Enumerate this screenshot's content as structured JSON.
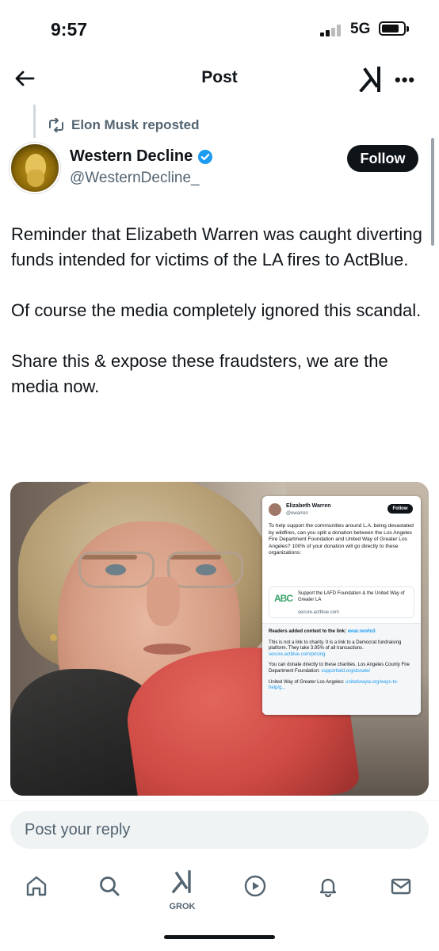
{
  "status_bar": {
    "time": "9:57",
    "network": "5G"
  },
  "header": {
    "title": "Post"
  },
  "repost": {
    "label": "Elon Musk reposted"
  },
  "author": {
    "name": "Western Decline",
    "handle": "@WesternDecline_",
    "follow_label": "Follow"
  },
  "post": {
    "paragraphs": [
      "Reminder that Elizabeth Warren was caught diverting funds intended for victims of the LA fires to ActBlue.",
      "Of course the media completely ignored this scandal.",
      "Share this & expose these fraudsters, we are the media now."
    ]
  },
  "media": {
    "inset": {
      "name": "Elizabeth Warren",
      "handle": "@ewarren",
      "follow_label": "Follow",
      "body": "To help support the communities around L.A. being devastated by wildfires, can you split a donation between the Los Angeles Fire Department Foundation and United Way of Greater Los Angeles? 100% of your donation will go directly to these organizations:",
      "card_logo": "ABC",
      "card_title": "Support the LAFD Foundation & the United Way of Greater LA",
      "card_url": "secure.actblue.com",
      "notes_title": "Readers added context to the link:",
      "notes_title_link": "ewar.ren/to3",
      "note_1": "This is not a link to charity. It is a link to a Democrat fundraising platform. They take 3.95% of all transactions.",
      "note_1_link": "secure.actblue.com/pricing",
      "note_2": "You can donate directly to these charities. Los Angeles County Fire Department Foundation:",
      "note_2_link": "supportlafd.org/donate/",
      "note_3": "United Way of Greater Los Angeles:",
      "note_3_link": "unitedwayla.org/ways-to-help/g..."
    }
  },
  "reply": {
    "placeholder": "Post your reply"
  },
  "tab_bar": {
    "items": [
      {
        "name": "home",
        "icon": "home-icon"
      },
      {
        "name": "search",
        "icon": "search-icon"
      },
      {
        "name": "grok",
        "icon": "grok-icon",
        "label": "GROK"
      },
      {
        "name": "video",
        "icon": "play-icon"
      },
      {
        "name": "notifications",
        "icon": "bell-icon"
      },
      {
        "name": "messages",
        "icon": "mail-icon"
      }
    ]
  },
  "colors": {
    "accent": "#1d9bf0",
    "text": "#0f1419",
    "secondary": "#536471"
  }
}
